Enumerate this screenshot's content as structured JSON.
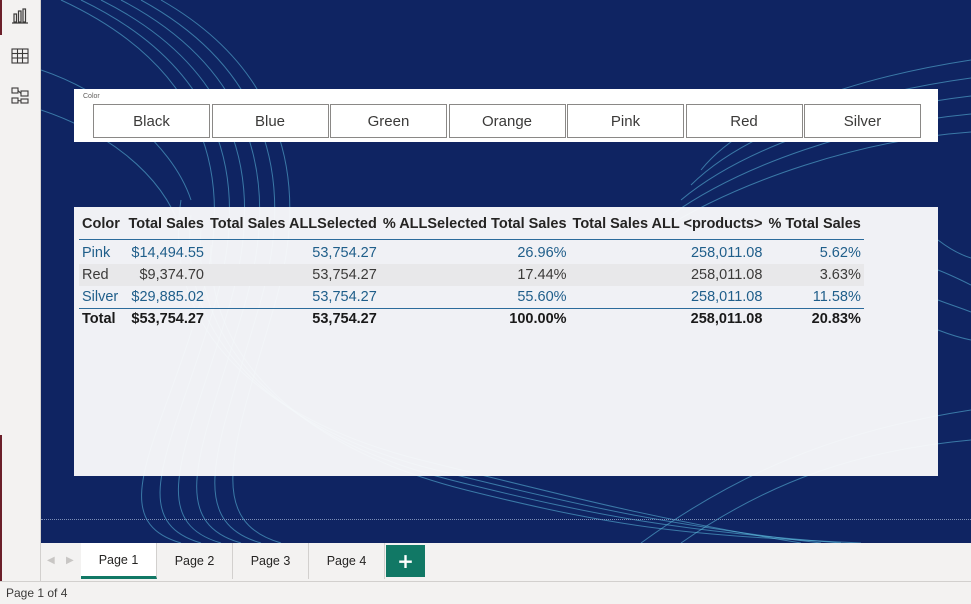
{
  "slicer": {
    "title": "Color",
    "options": [
      "Black",
      "Blue",
      "Green",
      "Orange",
      "Pink",
      "Red",
      "Silver"
    ]
  },
  "table": {
    "headers": [
      "Color",
      "Total Sales",
      "Total Sales ALLSelected",
      "% ALLSelected Total Sales",
      "Total Sales ALL <products>",
      "% Total Sales"
    ],
    "rows": [
      [
        "Pink",
        "$14,494.55",
        "53,754.27",
        "26.96%",
        "258,011.08",
        "5.62%"
      ],
      [
        "Red",
        "$9,374.70",
        "53,754.27",
        "17.44%",
        "258,011.08",
        "3.63%"
      ],
      [
        "Silver",
        "$29,885.02",
        "53,754.27",
        "55.60%",
        "258,011.08",
        "11.58%"
      ]
    ],
    "total": [
      "Total",
      "$53,754.27",
      "53,754.27",
      "100.00%",
      "258,011.08",
      "20.83%"
    ]
  },
  "tabs": [
    "Page 1",
    "Page 2",
    "Page 3",
    "Page 4"
  ],
  "add_page_label": "+",
  "status": {
    "text": "Page 1 of 4"
  },
  "rail": {
    "icons": [
      "report-view-icon",
      "table-view-icon",
      "model-view-icon"
    ]
  },
  "colors": {
    "canvas": "#0f2462",
    "accent": "#117865",
    "wave": "#5fc0e0"
  }
}
